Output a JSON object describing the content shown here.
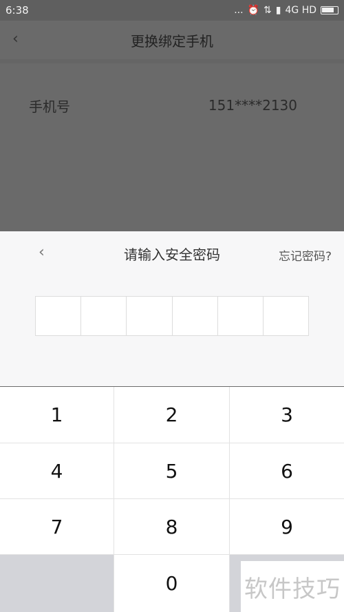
{
  "status_bar": {
    "time": "6:38",
    "dots": "...",
    "network": "4G HD",
    "icons": [
      "alarm-icon",
      "data-arrows-icon",
      "signal-icon",
      "battery-icon"
    ]
  },
  "page": {
    "back_glyph": "‹",
    "title": "更换绑定手机",
    "phone_label": "手机号",
    "phone_value": "151****2130"
  },
  "sheet": {
    "back_glyph": "‹",
    "title": "请输入安全密码",
    "forgot": "忘记密码?",
    "pin_length": 6
  },
  "keypad": {
    "keys": [
      "1",
      "2",
      "3",
      "4",
      "5",
      "6",
      "7",
      "8",
      "9",
      "",
      "0",
      ""
    ]
  },
  "watermark": "软件技巧"
}
